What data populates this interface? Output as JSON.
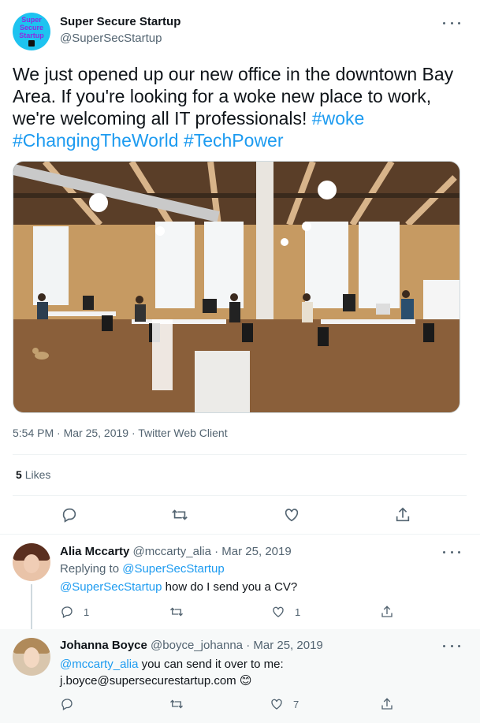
{
  "main_tweet": {
    "display_name": "Super Secure Startup",
    "handle": "@SuperSecStartup",
    "avatar_text": "Super Secure Startup",
    "text": "We just opened up our new office in the downtown Bay Area. If you're looking for a woke new place to work, we're welcoming all IT professionals!",
    "hashtags": [
      "#woke",
      "#ChangingTheWorld",
      "#TechPower"
    ],
    "timestamp": "5:54 PM · Mar 25, 2019 · Twitter Web Client",
    "likes_count": "5",
    "likes_label": "Likes"
  },
  "replies": [
    {
      "display_name": "Alia Mccarty",
      "handle": "@mccarty_alia",
      "date": "· Mar 25, 2019",
      "replying_to_prefix": "Replying to",
      "replying_to_handle": "@SuperSecStartup",
      "mention": "@SuperSecStartup",
      "text": " how do I send you a CV?",
      "reply_count": "1",
      "retweet_count": "",
      "like_count": "1"
    },
    {
      "display_name": "Johanna Boyce",
      "handle": "@boyce_johanna",
      "date": "· Mar 25, 2019",
      "mention": "@mccarty_alia",
      "text": " you can send it over to me:",
      "text_line2": "j.boyce@supersecurestartup.com",
      "emoji": "😊",
      "reply_count": "",
      "retweet_count": "",
      "like_count": "7"
    }
  ],
  "colors": {
    "accent": "#1d9bf0",
    "muted": "#536471",
    "divider": "#eff3f4"
  },
  "icons": [
    "more-icon",
    "reply-icon",
    "retweet-icon",
    "like-icon",
    "share-icon",
    "lock-icon"
  ]
}
